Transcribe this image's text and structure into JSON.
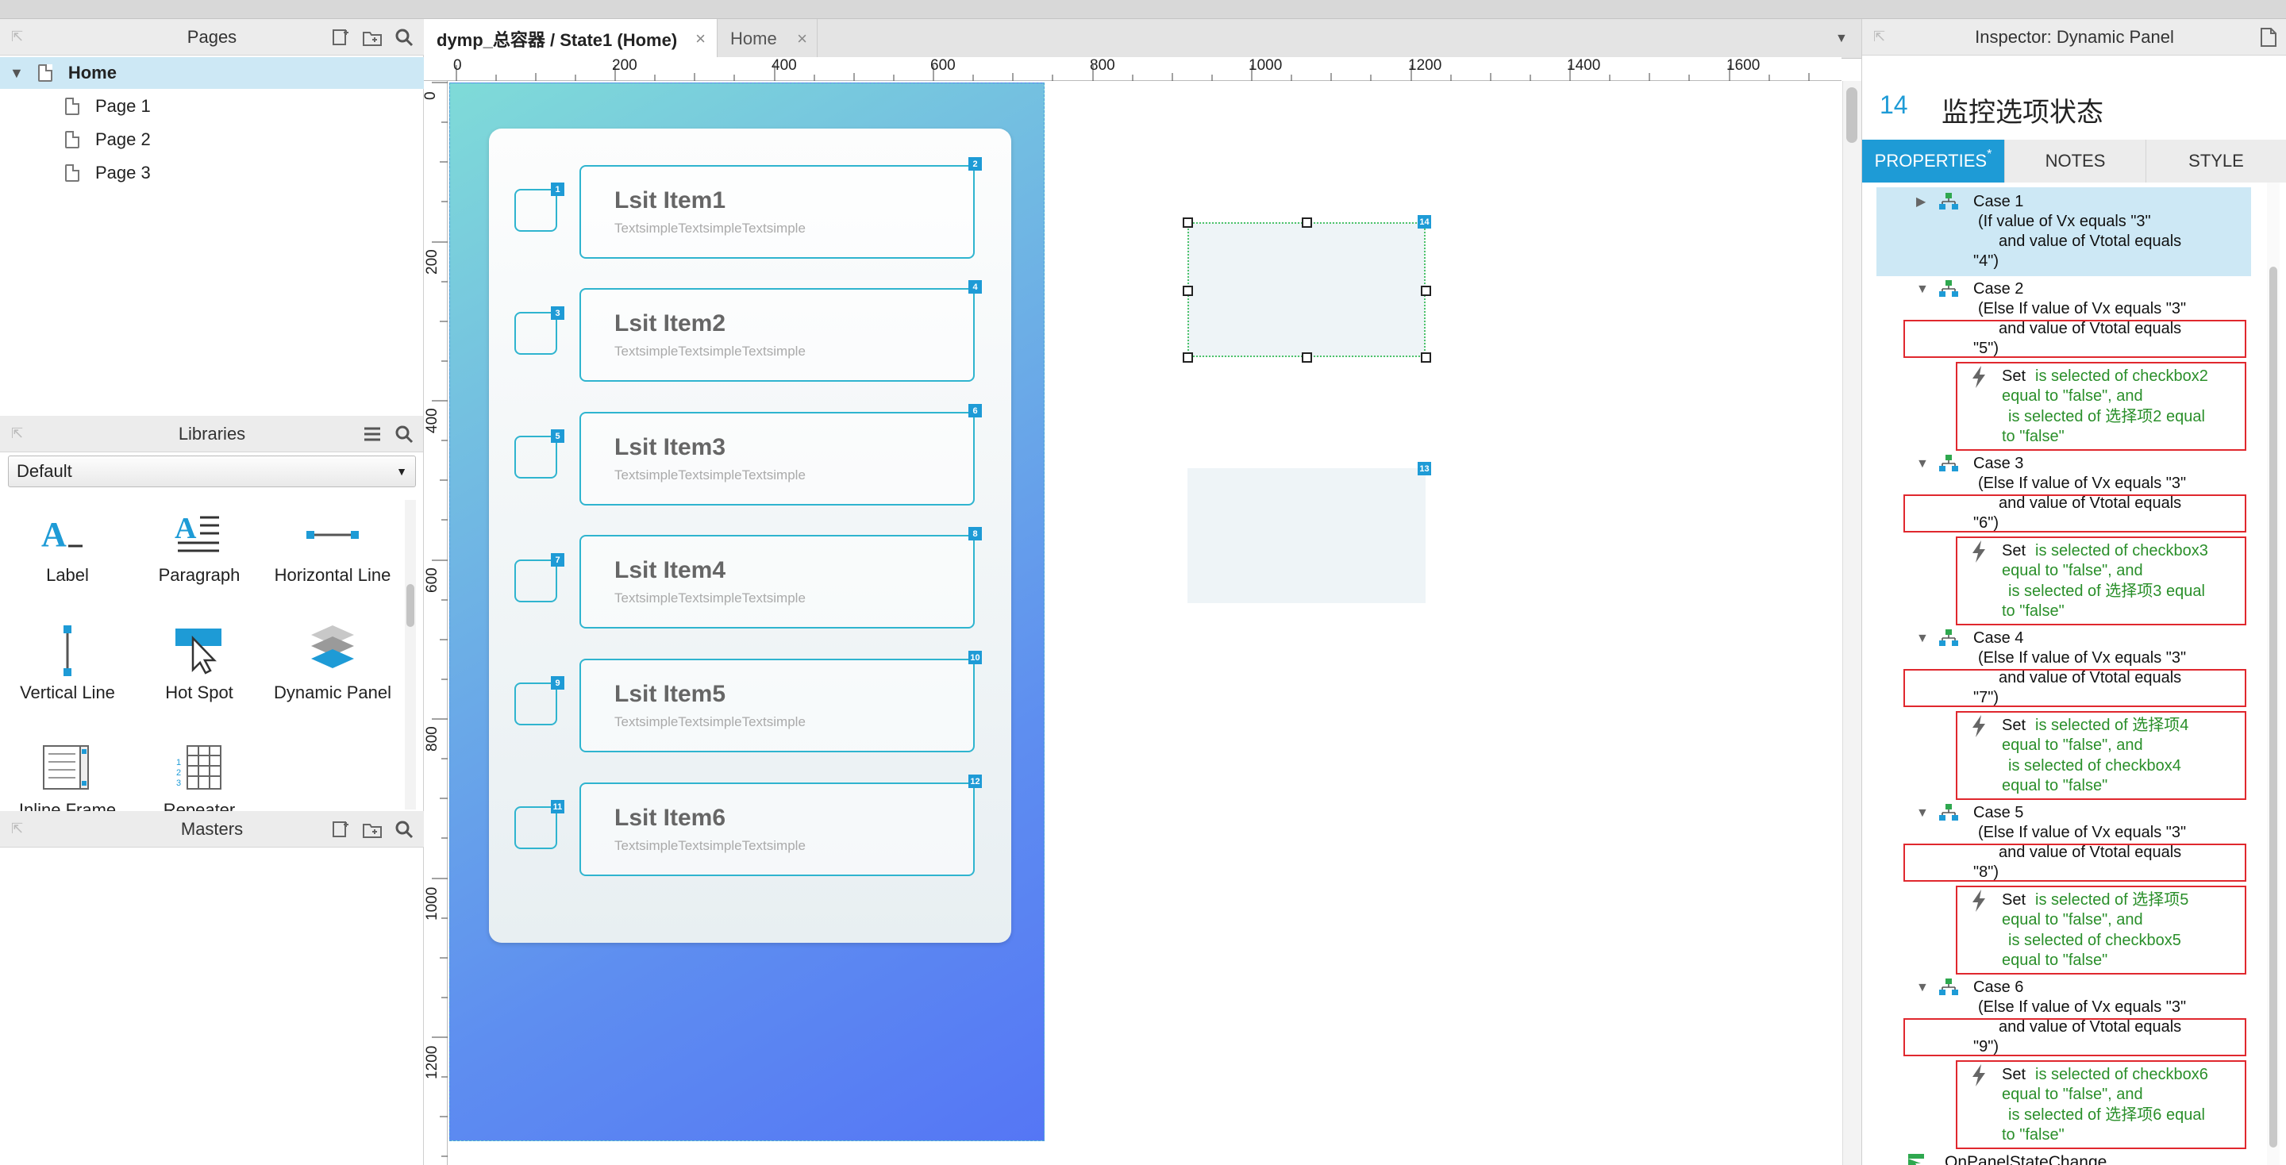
{
  "pages_panel": {
    "title": "Pages",
    "items": [
      {
        "label": "Home",
        "level": 0
      },
      {
        "label": "Page 1",
        "level": 1
      },
      {
        "label": "Page 2",
        "level": 1
      },
      {
        "label": "Page 3",
        "level": 1
      }
    ]
  },
  "libraries_panel": {
    "title": "Libraries",
    "selected_library": "Default",
    "items": [
      {
        "label": "Label",
        "icon": "label-icon"
      },
      {
        "label": "Paragraph",
        "icon": "paragraph-icon"
      },
      {
        "label": "Horizontal Line",
        "icon": "horizontal-line-icon"
      },
      {
        "label": "Vertical Line",
        "icon": "vertical-line-icon"
      },
      {
        "label": "Hot Spot",
        "icon": "hot-spot-icon"
      },
      {
        "label": "Dynamic Panel",
        "icon": "dynamic-panel-icon"
      },
      {
        "label": "Inline Frame",
        "icon": "inline-frame-icon"
      },
      {
        "label": "Repeater",
        "icon": "repeater-icon"
      }
    ]
  },
  "masters_panel": {
    "title": "Masters"
  },
  "editor": {
    "tabs": [
      {
        "label": "dymp_总容器 / State1 (Home)",
        "active": true
      },
      {
        "label": "Home",
        "active": false
      }
    ],
    "ruler_h": [
      "0",
      "200",
      "400",
      "600",
      "800",
      "1000",
      "1200",
      "1400",
      "1600"
    ],
    "ruler_v": [
      "0",
      "200",
      "400",
      "600",
      "800",
      "1000",
      "1200"
    ]
  },
  "canvas": {
    "list_items": [
      {
        "title": "Lsit Item1",
        "subtitle": "TextsimpleTextsimpleTextsimple",
        "box_badge": "1",
        "card_badge": "2"
      },
      {
        "title": "Lsit Item2",
        "subtitle": "TextsimpleTextsimpleTextsimple",
        "box_badge": "3",
        "card_badge": "4"
      },
      {
        "title": "Lsit Item3",
        "subtitle": "TextsimpleTextsimpleTextsimple",
        "box_badge": "5",
        "card_badge": "6"
      },
      {
        "title": "Lsit Item4",
        "subtitle": "TextsimpleTextsimpleTextsimple",
        "box_badge": "7",
        "card_badge": "8"
      },
      {
        "title": "Lsit Item5",
        "subtitle": "TextsimpleTextsimpleTextsimple",
        "box_badge": "9",
        "card_badge": "10"
      },
      {
        "title": "Lsit Item6",
        "subtitle": "TextsimpleTextsimpleTextsimple",
        "box_badge": "11",
        "card_badge": "12"
      }
    ],
    "panel_badge_selected": "14",
    "panel_badge_other": "13",
    "gradient_start": "#7fd9d9",
    "gradient_end": "#5576f5"
  },
  "inspector": {
    "title": "Inspector: Dynamic Panel",
    "widget_id": "14",
    "widget_name": "监控选项状态",
    "tabs": [
      {
        "label": "PROPERTIES",
        "active": true,
        "modified_marker": "*"
      },
      {
        "label": "NOTES",
        "active": false
      },
      {
        "label": "STYLE",
        "active": false
      }
    ],
    "cases": [
      {
        "name": "Case 1",
        "cond1": "(If value of Vx equals \"3\"",
        "cond2": "and value of Vtotal equals",
        "cond3": "\"4\")",
        "expanded": false
      },
      {
        "name": "Case 2",
        "cond1": "(Else If value of Vx equals \"3\"",
        "cond2": "and value of Vtotal equals",
        "cond3": "\"5\")",
        "expanded": true,
        "action": {
          "verb": "Set",
          "line1": "is selected of checkbox2",
          "line2": "equal to \"false\", and",
          "line3": "is selected of 选择项2 equal",
          "line4": "to \"false\""
        }
      },
      {
        "name": "Case 3",
        "cond1": "(Else If value of Vx equals \"3\"",
        "cond2": "and value of Vtotal equals",
        "cond3": "\"6\")",
        "expanded": true,
        "action": {
          "verb": "Set",
          "line1": "is selected of checkbox3",
          "line2": "equal to \"false\", and",
          "line3": "is selected of 选择项3 equal",
          "line4": "to \"false\""
        }
      },
      {
        "name": "Case 4",
        "cond1": "(Else If value of Vx equals \"3\"",
        "cond2": "and value of Vtotal equals",
        "cond3": "\"7\")",
        "expanded": true,
        "action": {
          "verb": "Set",
          "line1": "is selected of 选择项4",
          "line2": "equal to \"false\", and",
          "line3": "is selected of checkbox4",
          "line4": "equal to \"false\""
        }
      },
      {
        "name": "Case 5",
        "cond1": "(Else If value of Vx equals \"3\"",
        "cond2": "and value of Vtotal equals",
        "cond3": "\"8\")",
        "expanded": true,
        "action": {
          "verb": "Set",
          "line1": "is selected of 选择项5",
          "line2": "equal to \"false\", and",
          "line3": "is selected of checkbox5",
          "line4": "equal to \"false\""
        }
      },
      {
        "name": "Case 6",
        "cond1": "(Else If value of Vx equals \"3\"",
        "cond2": "and value of Vtotal equals",
        "cond3": "\"9\")",
        "expanded": true,
        "action": {
          "verb": "Set",
          "line1": "is selected of checkbox6",
          "line2": "equal to \"false\", and",
          "line3": "is selected of 选择项6 equal",
          "line4": "to \"false\""
        }
      }
    ],
    "event_footer": "OnPanelStateChange"
  },
  "colors": {
    "accent": "#1e9bd6",
    "selection": "#cde8f5",
    "annotation_red": "#e0282e",
    "action_green": "#2a8f2a"
  }
}
